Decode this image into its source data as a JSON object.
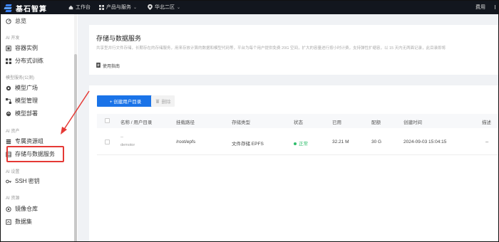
{
  "topbar": {
    "brand": "基石智算",
    "workbench": "工作台",
    "products": "产品与服务",
    "region": "华北二区",
    "fee": "费用"
  },
  "sidebar": {
    "overview": "总览",
    "groups": [
      {
        "title": "AI 开发",
        "items": [
          {
            "label": "容器实例",
            "icon": "container-icon"
          },
          {
            "label": "分布式训练",
            "icon": "distributed-icon"
          }
        ]
      },
      {
        "title": "模型服务(公测)",
        "items": [
          {
            "label": "模型广场",
            "icon": "model-square-icon"
          },
          {
            "label": "模型管理",
            "icon": "model-manage-icon"
          },
          {
            "label": "模型部署",
            "icon": "model-deploy-icon"
          }
        ]
      },
      {
        "title": "AI 资产",
        "items": [
          {
            "label": "专属资源组",
            "icon": "resource-group-icon"
          },
          {
            "label": "存储与数据服务",
            "icon": "storage-icon"
          }
        ]
      },
      {
        "title": "AI 设置",
        "items": [
          {
            "label": "SSH 密钥",
            "icon": "key-icon"
          }
        ]
      },
      {
        "title": "AI 资源",
        "items": [
          {
            "label": "镜像仓库",
            "icon": "image-repo-icon"
          },
          {
            "label": "数据集",
            "icon": "dataset-icon"
          }
        ]
      }
    ]
  },
  "intro": {
    "title": "存储与数据服务",
    "description": "共享型并行文件存储，长期存在的存储服务，用来存放计算的数据和模型代码等，平台为每个用户提供免费 20G 空间，扩大的容量进行按小时计费，支持弹性扩缩容，以 15 天内无两面记录，此目录即将",
    "guide": "使用指南"
  },
  "toolbar": {
    "create_label": "+ 创建用户目录",
    "delete_label": "删除"
  },
  "table": {
    "headers": [
      "名称 / 用户目录",
      "挂载路径",
      "存储类型",
      "状态",
      "已用",
      "配额",
      "创建时间",
      "描述"
    ],
    "rows": [
      {
        "name": "--",
        "dir": "demotor",
        "mount": "/root/epfs",
        "type": "文件存储 EPFS",
        "status": "正常",
        "used": "32.21 M",
        "quota": "30 G",
        "created": "2024-09-03 15:04:15",
        "desc": "--"
      }
    ]
  },
  "colors": {
    "primary": "#1a73e8",
    "topbar": "#12161e",
    "highlight": "#e53935",
    "success": "#2ebd6b"
  }
}
